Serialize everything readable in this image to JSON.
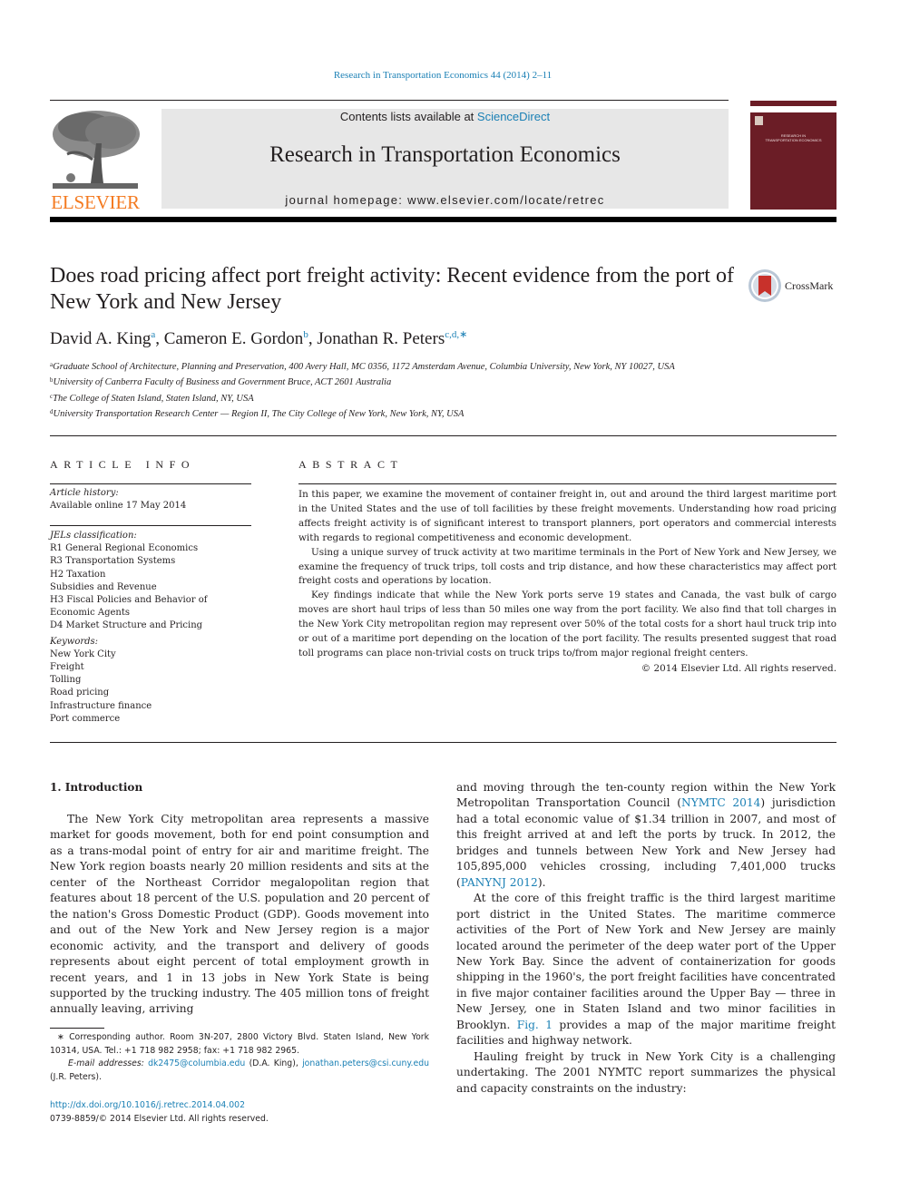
{
  "header": {
    "citation": "Research in Transportation Economics 44 (2014) 2–11",
    "contents_prefix": "Contents lists available at ",
    "contents_link": "ScienceDirect",
    "journal_name": "Research in Transportation Economics",
    "homepage_prefix": "journal homepage: ",
    "homepage_url": "www.elsevier.com/locate/retrec",
    "publisher_logo_text": "ELSEVIER",
    "cover_title_line1": "RESEARCH IN",
    "cover_title_line2": "TRANSPORTATION ECONOMICS",
    "colors": {
      "link": "#1b80b5",
      "elsevier_orange": "#f47a20",
      "cover": "#6b1d26"
    }
  },
  "article": {
    "title": "Does road pricing affect port freight activity: Recent evidence from the port of New York and New Jersey",
    "crossmark_label": "CrossMark",
    "authors": [
      {
        "name": "David A. King",
        "sup": "a"
      },
      {
        "name": "Cameron E. Gordon",
        "sup": "b"
      },
      {
        "name": "Jonathan R. Peters",
        "sup": "c,d,∗"
      }
    ],
    "affiliations": [
      {
        "key": "a",
        "text": "Graduate School of Architecture, Planning and Preservation, 400 Avery Hall, MC 0356, 1172 Amsterdam Avenue, Columbia University, New York, NY 10027, USA"
      },
      {
        "key": "b",
        "text": "University of Canberra Faculty of Business and Government Bruce, ACT 2601 Australia"
      },
      {
        "key": "c",
        "text": "The College of Staten Island, Staten Island, NY, USA"
      },
      {
        "key": "d",
        "text": "University Transportation Research Center — Region II, The City College of New York, New York, NY, USA"
      }
    ]
  },
  "article_info": {
    "heading": "ARTICLE INFO",
    "history_label": "Article history:",
    "history_value": "Available online 17 May 2014",
    "jel_label": "JELs classification:",
    "jel_items": [
      "R1 General Regional Economics",
      "R3 Transportation Systems",
      "H2 Taxation",
      "Subsidies and Revenue",
      "H3 Fiscal Policies and Behavior of Economic Agents",
      "D4 Market Structure and Pricing"
    ],
    "keywords_label": "Keywords:",
    "keywords": [
      "New York City",
      "Freight",
      "Tolling",
      "Road pricing",
      "Infrastructure finance",
      "Port commerce"
    ]
  },
  "abstract": {
    "heading": "ABSTRACT",
    "paragraphs": [
      "In this paper, we examine the movement of container freight in, out and around the third largest maritime port in the United States and the use of toll facilities by these freight movements. Understanding how road pricing affects freight activity is of significant interest to transport planners, port operators and commercial interests with regards to regional competitiveness and economic development.",
      "Using a unique survey of truck activity at two maritime terminals in the Port of New York and New Jersey, we examine the frequency of truck trips, toll costs and trip distance, and how these characteristics may affect port freight costs and operations by location.",
      "Key findings indicate that while the New York ports serve 19 states and Canada, the vast bulk of cargo moves are short haul trips of less than 50 miles one way from the port facility. We also find that toll charges in the New York City metropolitan region may represent over 50% of the total costs for a short haul truck trip into or out of a maritime port depending on the location of the port facility. The results presented suggest that road toll programs can place non-trivial costs on truck trips to/from major regional freight centers."
    ],
    "copyright": "© 2014 Elsevier Ltd. All rights reserved."
  },
  "body": {
    "intro_heading": "1.  Introduction",
    "left_paragraph": "The New York City metropolitan area represents a massive market for goods movement, both for end point consumption and as a trans-modal point of entry for air and maritime freight. The New York region boasts nearly 20 million residents and sits at the center of the Northeast Corridor megalopolitan region that features about 18 percent of the U.S. population and 20 percent of the nation's Gross Domestic Product (GDP). Goods movement into and out of the New York and New Jersey region is a major economic activity, and the transport and delivery of goods represents about eight percent of total employment growth in recent years, and 1 in 13 jobs in New York State is being supported by the trucking industry. The 405 million tons of freight annually leaving, arriving",
    "right_p1_a": "and moving through the ten-county region within the New York Metropolitan Transportation Council (",
    "right_p1_ref1": "NYMTC 2014",
    "right_p1_b": ") jurisdiction had a total economic value of $1.34 trillion in 2007, and most of this freight arrived at and left the ports by truck. In 2012, the bridges and tunnels between New York and New Jersey had 105,895,000 vehicles crossing, including 7,401,000 trucks (",
    "right_p1_ref2": "PANYNJ 2012",
    "right_p1_c": ").",
    "right_p2_a": "At the core of this freight traffic is the third largest maritime port district in the United States. The maritime commerce activities of the Port of New York and New Jersey are mainly located around the perimeter of the deep water port of the Upper New York Bay. Since the advent of containerization for goods shipping in the 1960's, the port freight facilities have concentrated in five major container facilities around the Upper Bay — three in New Jersey, one in Staten Island and two minor facilities in Brooklyn. ",
    "right_p2_ref": "Fig. 1",
    "right_p2_b": " provides a map of the major maritime freight facilities and highway network.",
    "right_p3": "Hauling freight by truck in New York City is a challenging undertaking. The 2001 NYMTC report summarizes the physical and capacity constraints on the industry:"
  },
  "footnote": {
    "corresponding": "∗ Corresponding author. Room 3N-207, 2800 Victory Blvd. Staten Island, New York 10314, USA. Tel.: +1 718 982 2958; fax: +1 718 982 2965.",
    "email_label": "E-mail addresses: ",
    "email1": "dk2475@columbia.edu",
    "email1_owner": " (D.A. King), ",
    "email2": "jonathan.peters@csi.cuny.edu",
    "email2_owner": " (J.R. Peters).",
    "doi": "http://dx.doi.org/10.1016/j.retrec.2014.04.002",
    "issn_line": "0739-8859/© 2014 Elsevier Ltd. All rights reserved."
  }
}
